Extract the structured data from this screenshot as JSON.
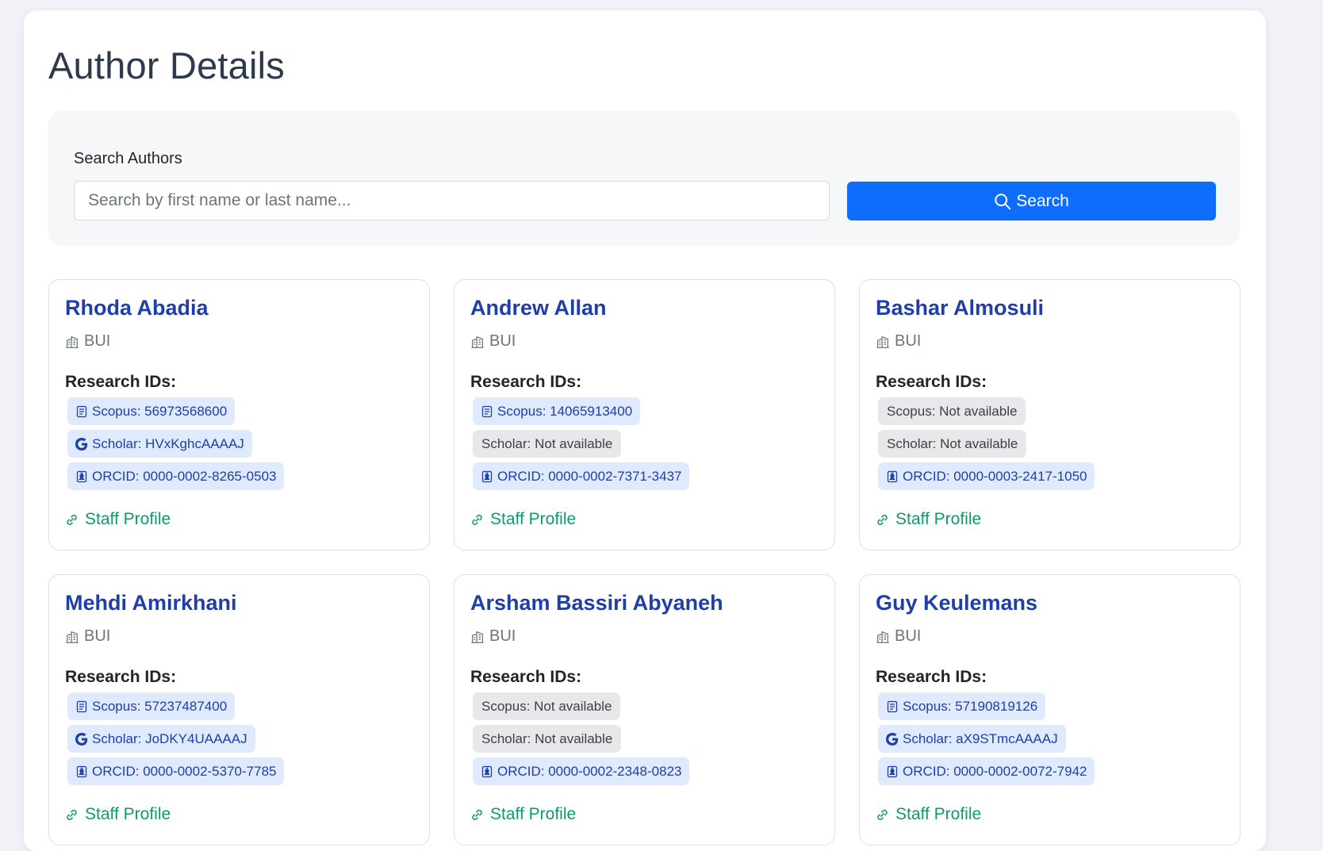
{
  "page": {
    "title": "Author Details"
  },
  "search": {
    "label": "Search Authors",
    "placeholder": "Search by first name or last name...",
    "value": "",
    "button_label": "Search"
  },
  "colors": {
    "primary": "#0d6efd",
    "name": "#1f3fa8",
    "link": "#0f9a6a",
    "badge_available_bg": "#dfeafe",
    "badge_missing_bg": "#e7e8ea"
  },
  "research_ids_label": "Research IDs:",
  "staff_profile_label": "Staff Profile",
  "authors": [
    {
      "name": "Rhoda Abadia",
      "affiliation": "BUI",
      "scopus": "Scopus: 56973568600",
      "scopus_available": true,
      "scholar": "Scholar: HVxKghcAAAAJ",
      "scholar_available": true,
      "orcid": "ORCID: 0000-0002-8265-0503",
      "orcid_available": true
    },
    {
      "name": "Andrew Allan",
      "affiliation": "BUI",
      "scopus": "Scopus: 14065913400",
      "scopus_available": true,
      "scholar": "Scholar: Not available",
      "scholar_available": false,
      "orcid": "ORCID: 0000-0002-7371-3437",
      "orcid_available": true
    },
    {
      "name": "Bashar Almosuli",
      "affiliation": "BUI",
      "scopus": "Scopus: Not available",
      "scopus_available": false,
      "scholar": "Scholar: Not available",
      "scholar_available": false,
      "orcid": "ORCID: 0000-0003-2417-1050",
      "orcid_available": true
    },
    {
      "name": "Mehdi Amirkhani",
      "affiliation": "BUI",
      "scopus": "Scopus: 57237487400",
      "scopus_available": true,
      "scholar": "Scholar: JoDKY4UAAAAJ",
      "scholar_available": true,
      "orcid": "ORCID: 0000-0002-5370-7785",
      "orcid_available": true
    },
    {
      "name": "Arsham Bassiri Abyaneh",
      "affiliation": "BUI",
      "scopus": "Scopus: Not available",
      "scopus_available": false,
      "scholar": "Scholar: Not available",
      "scholar_available": false,
      "orcid": "ORCID: 0000-0002-2348-0823",
      "orcid_available": true
    },
    {
      "name": "Guy Keulemans",
      "affiliation": "BUI",
      "scopus": "Scopus: 57190819126",
      "scopus_available": true,
      "scholar": "Scholar: aX9STmcAAAAJ",
      "scholar_available": true,
      "orcid": "ORCID: 0000-0002-0072-7942",
      "orcid_available": true
    }
  ]
}
